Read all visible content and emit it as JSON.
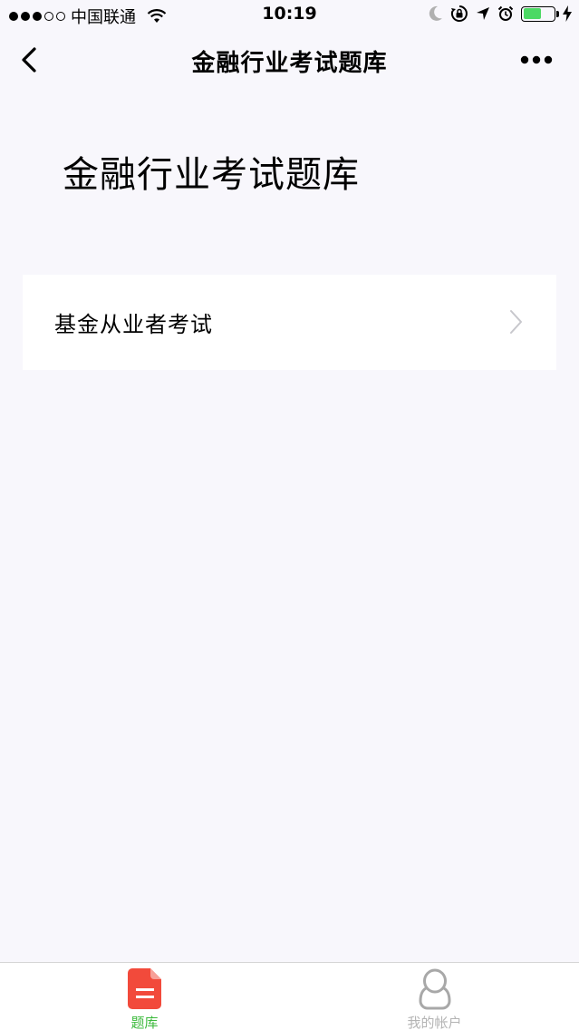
{
  "status_bar": {
    "carrier": "中国联通",
    "time": "10:19",
    "signal_strength": "3 of 5",
    "battery_level": 0.6,
    "battery_color": "#4cd964"
  },
  "nav": {
    "title": "金融行业考试题库",
    "back_icon": "chevron-left-icon",
    "more_icon": "more-dots-icon"
  },
  "page": {
    "heading": "金融行业考试题库",
    "items": [
      {
        "label": "基金从业者考试",
        "icon": "chevron-right-icon"
      }
    ]
  },
  "tabbar": {
    "tabs": [
      {
        "label": "题库",
        "icon": "document-icon",
        "active": true,
        "color": "#3cba3c",
        "icon_color": "#f24a3b"
      },
      {
        "label": "我的帐户",
        "icon": "person-icon",
        "active": false,
        "color": "#b4b4b4"
      }
    ]
  }
}
